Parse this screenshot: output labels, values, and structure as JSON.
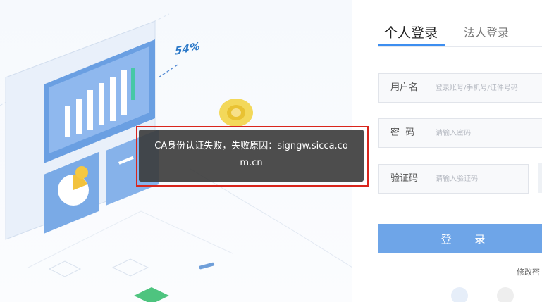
{
  "illustration": {
    "percent_label": "54%"
  },
  "login": {
    "tabs": [
      {
        "label": "个人登录",
        "active": true
      },
      {
        "label": "法人登录",
        "active": false
      }
    ],
    "username": {
      "label": "用户名",
      "placeholder": "登录账号/手机号/证件号码"
    },
    "password": {
      "label": "密  码",
      "placeholder": "请输入密码"
    },
    "captcha": {
      "label": "验证码",
      "placeholder": "请输入验证码"
    },
    "submit_label": "登 录",
    "change_password_label": "修改密"
  },
  "toast": {
    "message": "CA身份认证失败，失败原因：signgw.sicca.com.cn"
  },
  "colors": {
    "accent": "#3d8ef0",
    "button": "#6ea5e8",
    "toast_bg": "#3a3a3a",
    "highlight": "#d9251c"
  }
}
